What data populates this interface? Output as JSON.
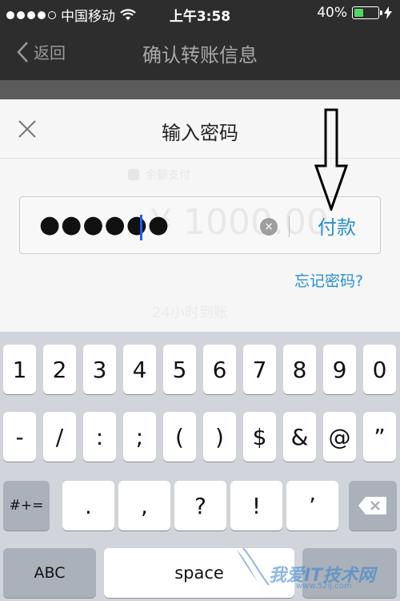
{
  "status_bar": {
    "carrier": "中国移动",
    "time": "上午3:58",
    "battery_percent": "40%",
    "battery_level": 0.4,
    "icons": [
      "signal-dots-icon",
      "wifi-icon",
      "battery-icon",
      "charging-bolt-icon"
    ]
  },
  "nav": {
    "back_label": "返回",
    "title": "确认转账信息"
  },
  "dialog": {
    "title": "输入密码",
    "password_mask": "●●●●●●",
    "obscured_amount": "¥ 1000.00",
    "obscured_top_text": "余额支付",
    "pay_label": "付款",
    "forgot_label": "忘记密码?",
    "obscured_bottom_text": "24小时到账",
    "clear_symbol": "×"
  },
  "keyboard": {
    "row1": [
      "1",
      "2",
      "3",
      "4",
      "5",
      "6",
      "7",
      "8",
      "9",
      "0"
    ],
    "row2": [
      "-",
      "/",
      ":",
      ";",
      "(",
      ")",
      "$",
      "&",
      "@",
      "”"
    ],
    "row3": [
      "#+=",
      ".",
      ",",
      "?",
      "!",
      "’"
    ],
    "abc_label": "ABC",
    "space_label": "space"
  },
  "watermark": {
    "text": "我爱IT技术网",
    "sub": "www.52ij.com"
  },
  "colors": {
    "accent_blue": "#2a8fd6",
    "caret_blue": "#1a5cff",
    "battery_green": "#4cd964"
  }
}
